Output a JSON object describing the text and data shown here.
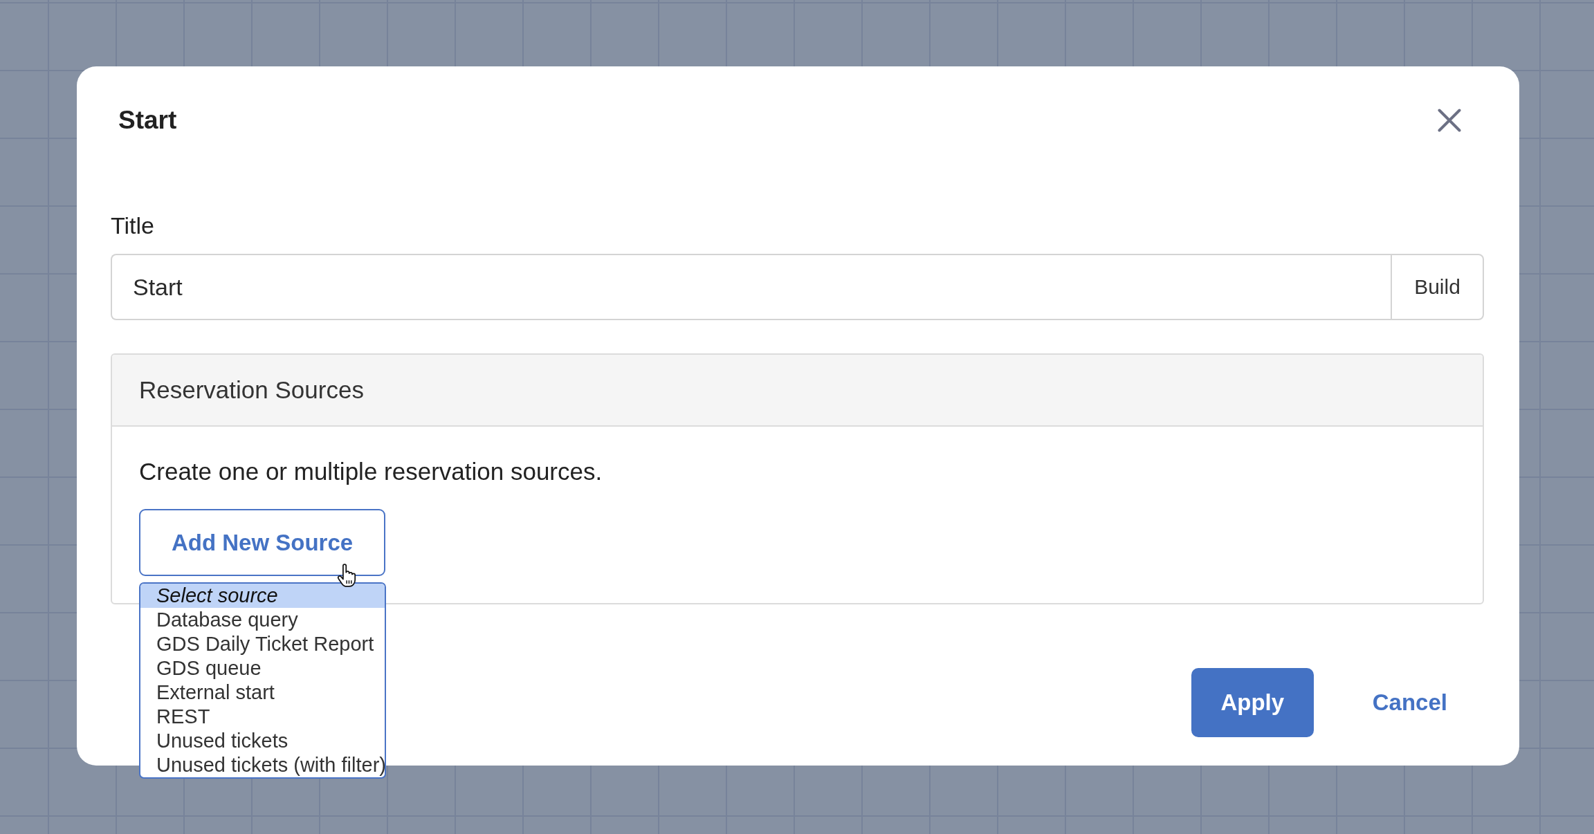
{
  "dialog": {
    "title": "Start"
  },
  "title_field": {
    "label": "Title",
    "value": "Start",
    "addon_button": "Build"
  },
  "sources_panel": {
    "heading": "Reservation Sources",
    "description": "Create one or multiple reservation sources.",
    "add_button": "Add New Source"
  },
  "source_menu": {
    "options": [
      {
        "label": "Select source",
        "kind": "prompt",
        "selected": true
      },
      {
        "label": "Database query",
        "kind": "option",
        "selected": false
      },
      {
        "label": "GDS Daily Ticket Report",
        "kind": "option",
        "selected": false
      },
      {
        "label": "GDS queue",
        "kind": "option",
        "selected": false
      },
      {
        "label": "External start",
        "kind": "option",
        "selected": false
      },
      {
        "label": "REST",
        "kind": "option",
        "selected": false
      },
      {
        "label": "Unused tickets",
        "kind": "option",
        "selected": false
      },
      {
        "label": "Unused tickets (with filter)",
        "kind": "option",
        "selected": false
      }
    ]
  },
  "buttons": [
    {
      "label": "Apply",
      "kind": "primary"
    },
    {
      "label": "Cancel",
      "kind": "link"
    }
  ]
}
